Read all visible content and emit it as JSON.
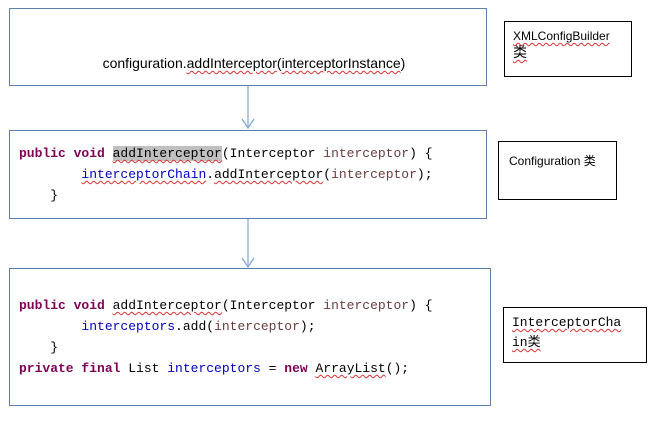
{
  "box1": {
    "text_a": "configuration.",
    "text_b": "addInterceptor",
    "text_c": "(",
    "text_d": "interceptorInstance",
    "text_e": ")"
  },
  "box2": {
    "l1_kw": "public void ",
    "l1_method": "addInterceptor",
    "l1_mid": "(Interceptor ",
    "l1_param": "interceptor",
    "l1_end": ") {",
    "l2_indent": "        ",
    "l2_field": "interceptorChain",
    "l2_dot": ".",
    "l2_call": "addInterceptor",
    "l2_open": "(",
    "l2_arg": "interceptor",
    "l2_end": ");",
    "l3": "    }"
  },
  "box3": {
    "l1_kw": "public void ",
    "l1_method": "addInterceptor",
    "l1_mid": "(Interceptor ",
    "l1_param": "interceptor",
    "l1_end": ") {",
    "l2_indent": "        ",
    "l2_field": "interceptors",
    "l2_rest": ".add(",
    "l2_arg": "interceptor",
    "l2_end": ");",
    "l3": "    }",
    "l4_kw": "private final ",
    "l4_type": "List ",
    "l4_field": "interceptors",
    "l4_eq": " = ",
    "l4_new": "new ",
    "l4_cls": "ArrayList",
    "l4_end": "();"
  },
  "labels": {
    "l1_line1": "XMLConfigBuilder",
    "l1_line2": "类",
    "l2": "Configuration 类",
    "l3_line1": "InterceptorCha",
    "l3_line2": "in类"
  },
  "colors": {
    "box_border": "#5b7fa6",
    "arrow": "#7aa3d0",
    "keyword": "#7f0055",
    "field": "#0000c0",
    "param": "#6a3e3e"
  }
}
